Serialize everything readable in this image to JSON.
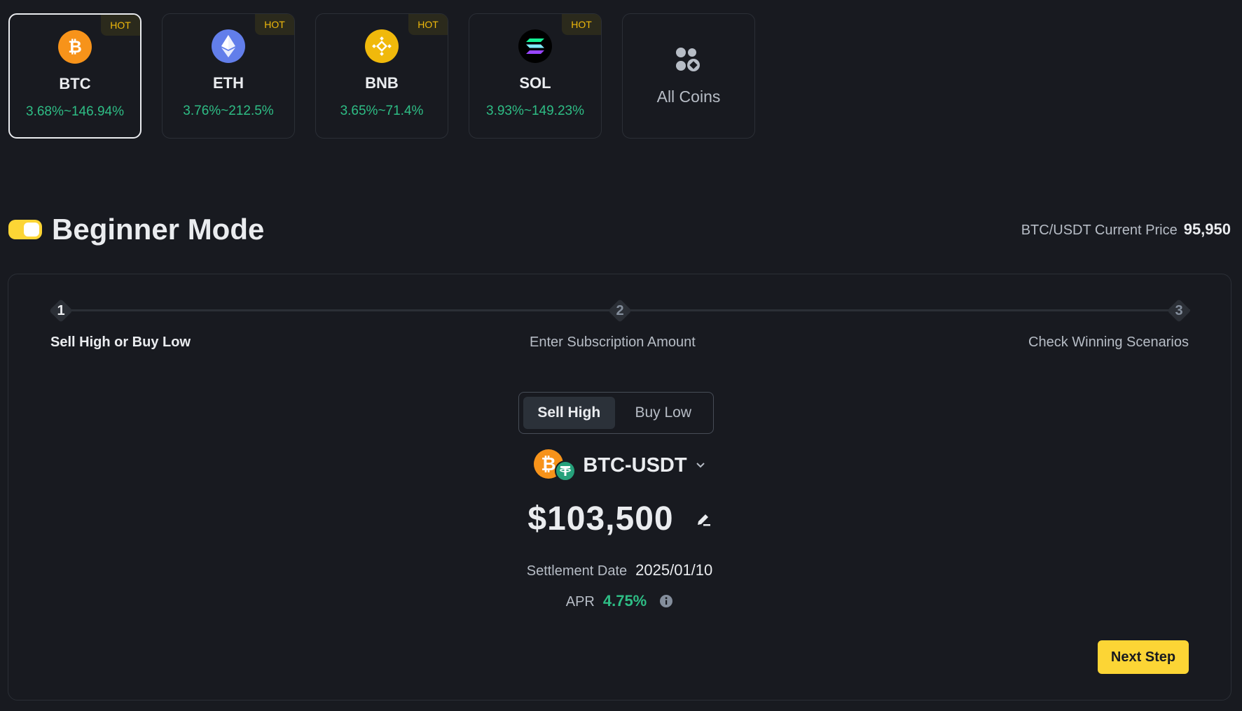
{
  "coins": [
    {
      "symbol": "BTC",
      "apr_range": "3.68%~146.94%",
      "badge": "HOT",
      "icon": "btc-icon",
      "color": "#f7931a"
    },
    {
      "symbol": "ETH",
      "apr_range": "3.76%~212.5%",
      "badge": "HOT",
      "icon": "eth-icon",
      "color": "#627eea"
    },
    {
      "symbol": "BNB",
      "apr_range": "3.65%~71.4%",
      "badge": "HOT",
      "icon": "bnb-icon",
      "color": "#f0b90b"
    },
    {
      "symbol": "SOL",
      "apr_range": "3.93%~149.23%",
      "badge": "HOT",
      "icon": "sol-icon",
      "color": "#000000"
    }
  ],
  "all_coins": {
    "label": "All Coins",
    "icon": "all-coins-icon"
  },
  "mode": {
    "toggle_on": true,
    "title": "Beginner Mode"
  },
  "price": {
    "label": "BTC/USDT Current Price",
    "value": "95,950"
  },
  "steps": [
    {
      "number": "1",
      "label": "Sell High or Buy Low",
      "active": true
    },
    {
      "number": "2",
      "label": "Enter Subscription Amount",
      "active": false
    },
    {
      "number": "3",
      "label": "Check Winning Scenarios",
      "active": false
    }
  ],
  "direction": {
    "options": [
      "Sell High",
      "Buy Low"
    ],
    "selected": "Sell High"
  },
  "pair": {
    "name": "BTC-USDT",
    "icon": "chevron-down-icon"
  },
  "strike": {
    "value": "$103,500",
    "icon": "edit-icon"
  },
  "settlement": {
    "label": "Settlement Date",
    "value": "2025/01/10"
  },
  "apr": {
    "label": "APR",
    "value": "4.75%",
    "icon": "info-icon"
  },
  "actions": {
    "next_label": "Next Step"
  },
  "colors": {
    "accent": "#fcd535",
    "positive": "#2ebd85",
    "background": "#181a20",
    "badge": "#f0b90b"
  }
}
